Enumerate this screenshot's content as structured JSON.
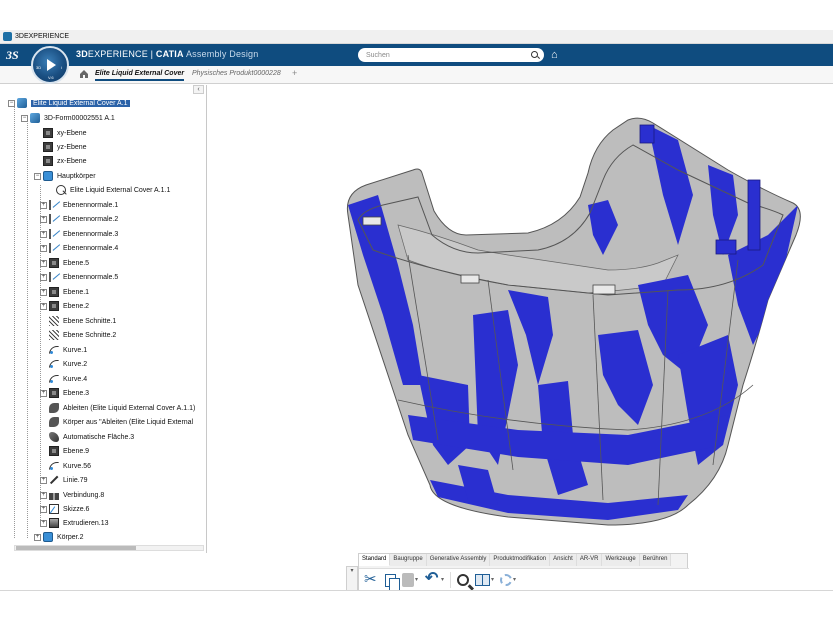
{
  "window": {
    "title": "3DEXPERIENCE"
  },
  "header": {
    "brand_bold": "3D",
    "brand_rest": "EXPERIENCE | ",
    "product": "CATIA",
    "app": "Assembly Design",
    "compass_version": "V.6",
    "search": {
      "placeholder": "Suchen"
    }
  },
  "tabs": [
    {
      "label": "Elite Liquid External Cover",
      "active": true
    },
    {
      "label": "Physisches Produkt0000228",
      "active": false
    }
  ],
  "tree": {
    "collapse_glyph": "‹",
    "nodes": [
      {
        "label": "Elite Liquid External Cover A.1",
        "icon": "product-icon",
        "selected": true
      },
      {
        "label": "3D-Form00002551 A.1",
        "icon": "part-icon"
      },
      {
        "label": "xy-Ebene",
        "icon": "plane-icon"
      },
      {
        "label": "yz-Ebene",
        "icon": "plane-icon"
      },
      {
        "label": "zx-Ebene",
        "icon": "plane-icon"
      },
      {
        "label": "Hauptkörper",
        "icon": "body-icon"
      },
      {
        "label": "Elite Liquid External Cover A.1.1",
        "icon": "geometry-icon"
      },
      {
        "label": "Ebenennormale.1",
        "icon": "plane-normal-icon"
      },
      {
        "label": "Ebenennormale.2",
        "icon": "plane-normal-icon"
      },
      {
        "label": "Ebenennormale.3",
        "icon": "plane-normal-icon"
      },
      {
        "label": "Ebenennormale.4",
        "icon": "plane-normal-icon"
      },
      {
        "label": "Ebene.5",
        "icon": "plane-icon"
      },
      {
        "label": "Ebenennormale.5",
        "icon": "plane-normal-icon"
      },
      {
        "label": "Ebene.1",
        "icon": "plane-icon"
      },
      {
        "label": "Ebene.2",
        "icon": "plane-icon"
      },
      {
        "label": "Ebene Schnitte.1",
        "icon": "section-icon"
      },
      {
        "label": "Ebene Schnitte.2",
        "icon": "section-icon"
      },
      {
        "label": "Kurve.1",
        "icon": "curve-icon"
      },
      {
        "label": "Kurve.2",
        "icon": "curve-icon"
      },
      {
        "label": "Kurve.4",
        "icon": "curve-icon"
      },
      {
        "label": "Ebene.3",
        "icon": "plane-icon"
      },
      {
        "label": "Ableiten (Elite Liquid External Cover A.1.1)",
        "icon": "derive-icon"
      },
      {
        "label": "Körper aus \"Ableiten (Elite Liquid External",
        "icon": "derive-icon"
      },
      {
        "label": "Automatische Fläche.3",
        "icon": "surface-icon"
      },
      {
        "label": "Ebene.9",
        "icon": "plane-icon"
      },
      {
        "label": "Kurve.56",
        "icon": "curve-icon"
      },
      {
        "label": "Linie.79",
        "icon": "line-icon"
      },
      {
        "label": "Verbindung.8",
        "icon": "join-icon"
      },
      {
        "label": "Skizze.6",
        "icon": "sketch-icon"
      },
      {
        "label": "Extrudieren.13",
        "icon": "extrude-icon"
      },
      {
        "label": "Körper.2",
        "icon": "body-icon"
      }
    ]
  },
  "actionbar": {
    "tabs": [
      "Standard",
      "Baugruppe",
      "Generative Assembly",
      "Produktmodifikation",
      "Ansicht",
      "AR-VR",
      "Werkzeuge",
      "Berühren"
    ],
    "active_tab": "Standard",
    "icons": [
      "scissors-icon",
      "copy-icon",
      "paste-icon",
      "undo-icon",
      "zoom-icon",
      "book-icon",
      "gear-icon"
    ]
  },
  "colors": {
    "header_bg": "#0f4c7f",
    "model_blue": "#2a2fd0",
    "model_grey": "#b9b9b9",
    "selection": "#2b62a8"
  }
}
